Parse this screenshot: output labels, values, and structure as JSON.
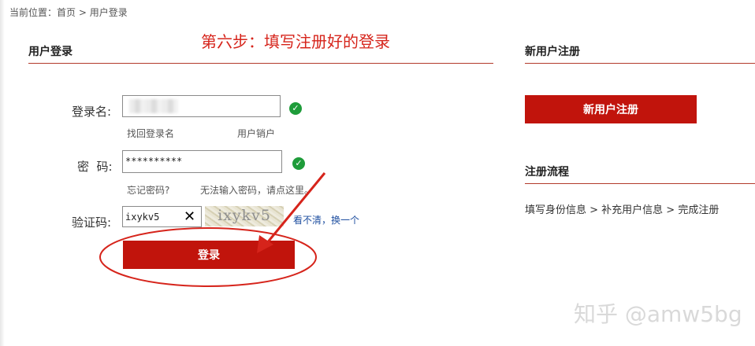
{
  "breadcrumb": {
    "prefix": "当前位置：",
    "home": "首页",
    "separator": " > ",
    "current": "用户登录"
  },
  "login": {
    "section_title": "用户登录",
    "annotation": "第六步：填写注册好的登录",
    "username_label": "登录名:",
    "find_username": "找回登录名",
    "cancel_account": "用户销户",
    "password_label": "密  码:",
    "password_value": "**********",
    "forgot_password": "忘记密码?",
    "cannot_input": "无法输入密码，请点这里。",
    "captcha_label": "验证码:",
    "captcha_value": "ixykv5",
    "clear_symbol": "✕",
    "captcha_image_text": "ixykv5",
    "refresh_label": "看不清，换一个",
    "submit_label": "登录"
  },
  "register": {
    "section_title": "新用户注册",
    "button_label": "新用户注册"
  },
  "flow": {
    "section_title": "注册流程",
    "steps": "填写身份信息 > 补充用户信息 > 完成注册"
  },
  "watermark": "知乎 @amw5bg",
  "icons": {
    "check": "check-circle-icon",
    "clear": "close-icon"
  },
  "colors": {
    "accent": "#c1140c",
    "annotation": "#d6241b",
    "check": "#1e9c3a",
    "link": "#1f4fa0"
  }
}
